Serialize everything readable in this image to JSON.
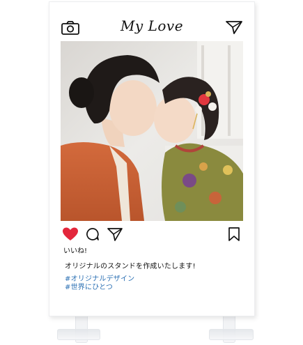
{
  "post": {
    "title": "My Love",
    "likes_label": "いいね!",
    "caption": "オリジナルのスタンドを作成いたします!",
    "hashtags": [
      "#オリジナルデザイン",
      "#世界にひとつ"
    ],
    "icons": {
      "header_left": "camera-icon",
      "header_right": "send-icon",
      "actions": [
        "heart-icon",
        "comment-icon",
        "share-icon"
      ],
      "save": "bookmark-icon"
    },
    "colors": {
      "heart": "#e3263b",
      "hashtag": "#2a6fb3",
      "text": "#111111"
    }
  }
}
